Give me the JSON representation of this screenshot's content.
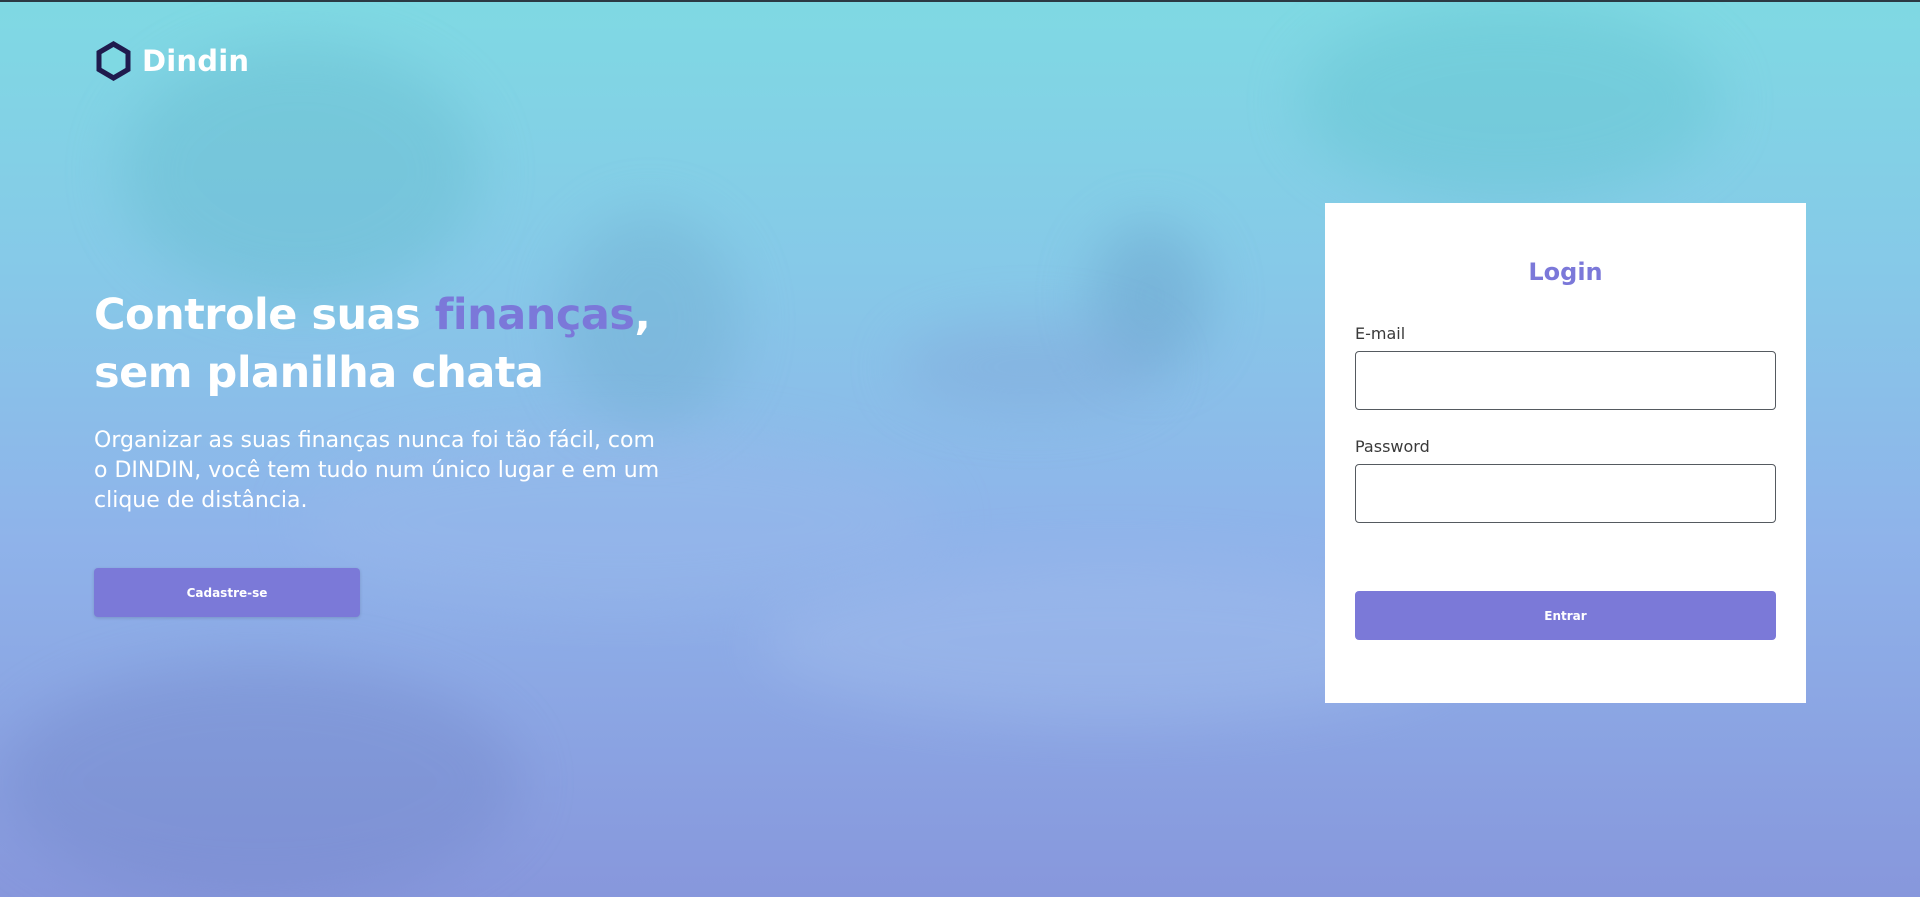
{
  "brand": {
    "name": "Dindin",
    "logo_icon": "hexagon-icon",
    "colors": {
      "accent": "#7b78d9",
      "button": "#7b79d8",
      "logo_dark": "#1f1b4d",
      "logo_fill": "#7fd9e3"
    }
  },
  "hero": {
    "title_part1": "Controle suas ",
    "title_accent": "finanças",
    "title_part2": ",",
    "title_line2": "sem planilha chata",
    "subtitle": "Organizar as suas finanças nunca foi tão fácil, com o DINDIN, você tem tudo num único lugar e em um clique de distância.",
    "signup_label": "Cadastre-se"
  },
  "login": {
    "title": "Login",
    "email_label": "E-mail",
    "email_value": "",
    "password_label": "Password",
    "password_value": "",
    "submit_label": "Entrar"
  }
}
